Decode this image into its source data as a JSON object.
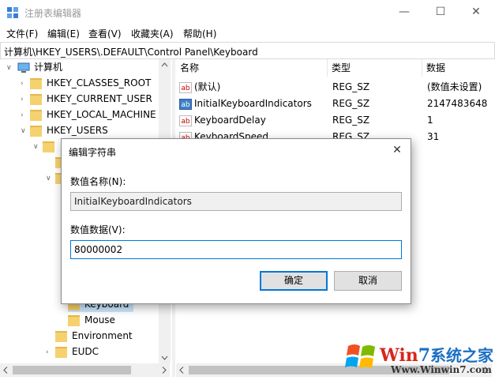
{
  "window": {
    "title": "注册表编辑器"
  },
  "window_controls": {
    "minimize": "—",
    "maximize": "☐",
    "close": "✕"
  },
  "menu": [
    "文件(F)",
    "编辑(E)",
    "查看(V)",
    "收藏夹(A)",
    "帮助(H)"
  ],
  "address": "计算机\\HKEY_USERS\\.DEFAULT\\Control Panel\\Keyboard",
  "tree": {
    "root": "计算机",
    "hives": [
      "HKEY_CLASSES_ROOT",
      "HKEY_CURRENT_USER",
      "HKEY_LOCAL_MACHINE",
      "HKEY_USERS"
    ],
    "selected": "Keyboard",
    "children": [
      "Mouse",
      "Environment",
      "EUDC"
    ]
  },
  "list": {
    "headers": {
      "name": "名称",
      "type": "类型",
      "data": "数据"
    },
    "rows": [
      {
        "icon": "string-value-icon",
        "name": "(默认)",
        "type": "REG_SZ",
        "data": "(数值未设置)"
      },
      {
        "icon": "binary-value-icon",
        "name": "InitialKeyboardIndicators",
        "type": "REG_SZ",
        "data": "2147483648"
      },
      {
        "icon": "string-value-icon",
        "name": "KeyboardDelay",
        "type": "REG_SZ",
        "data": "1"
      },
      {
        "icon": "string-value-icon",
        "name": "KeyboardSpeed",
        "type": "REG_SZ",
        "data": "31"
      }
    ]
  },
  "dialog": {
    "title": "编辑字符串",
    "close": "✕",
    "name_label": "数值名称(N):",
    "name_value": "InitialKeyboardIndicators",
    "data_label": "数值数据(V):",
    "data_value": "80000002",
    "ok": "确定",
    "cancel": "取消"
  },
  "watermark": {
    "brand_prefix": "Wi",
    "brand_n": "n",
    "brand_7": "7",
    "brand_suffix": "系统之家",
    "url": "Www.Winwin7.com"
  },
  "colors": {
    "accent": "#0078d7",
    "folder": "#f5d26e",
    "brand_red": "#d9251d",
    "brand_blue": "#1b6fc4"
  }
}
